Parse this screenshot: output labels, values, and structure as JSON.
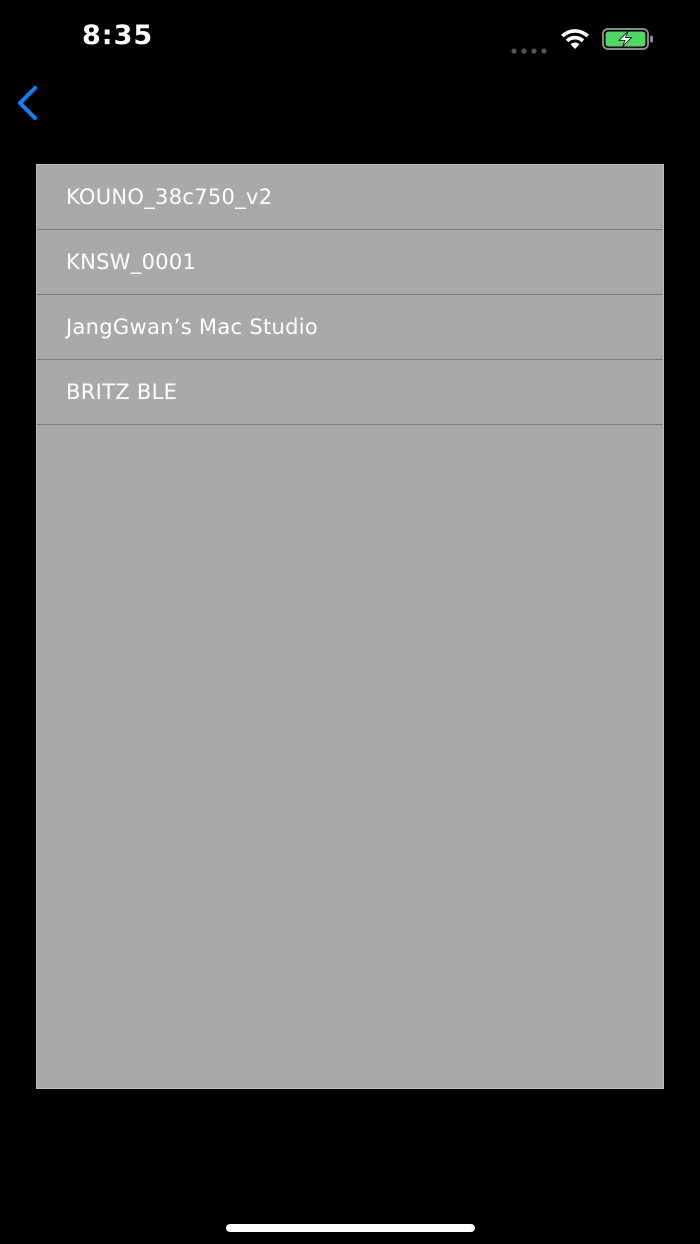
{
  "status_bar": {
    "time": "8:35",
    "signal_icon": "cellular-dots-icon",
    "wifi_icon": "wifi-icon",
    "battery_icon": "battery-charging-icon",
    "battery_color": "#4cd964"
  },
  "nav": {
    "back_icon": "chevron-left-icon",
    "accent_color": "#0a84ff"
  },
  "devices": [
    {
      "label": "KOUNO_38c750_v2"
    },
    {
      "label": "KNSW_0001"
    },
    {
      "label": "JangGwan’s Mac Studio"
    },
    {
      "label": "BRITZ BLE"
    }
  ],
  "colors": {
    "background": "#000000",
    "list_background": "#a9a9a9",
    "row_text": "#ffffff"
  }
}
